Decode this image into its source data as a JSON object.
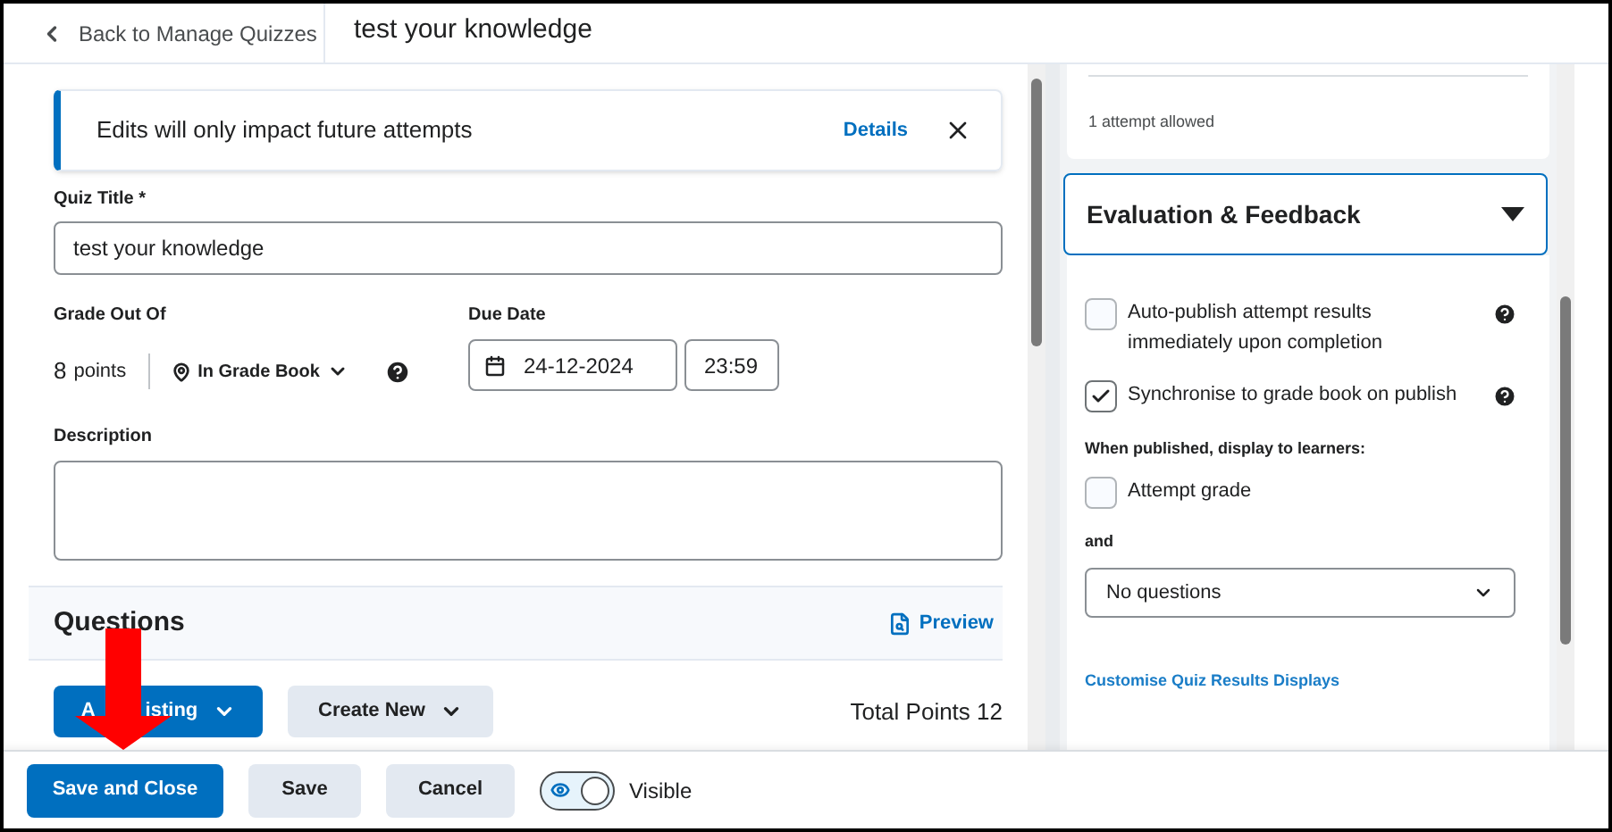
{
  "header": {
    "back_link": "Back to Manage Quizzes",
    "title": "test your knowledge"
  },
  "notice": {
    "text": "Edits will only impact future attempts",
    "link": "Details"
  },
  "quiz_title": {
    "label": "Quiz Title *",
    "value": "test your knowledge"
  },
  "grade": {
    "label": "Grade Out Of",
    "points_value": "8",
    "points_unit": "points",
    "grade_book": "In Grade Book"
  },
  "due_date": {
    "label": "Due Date",
    "date": "24-12-2024",
    "time": "23:59"
  },
  "description": {
    "label": "Description"
  },
  "questions": {
    "title": "Questions",
    "preview": "Preview",
    "buttons": [
      {
        "label_parts": [
          "A",
          "isting"
        ],
        "kind": "primary"
      },
      {
        "label": "Create New",
        "kind": "secondary"
      }
    ],
    "total": "Total Points 12"
  },
  "right_panel": {
    "attempts": "1 attempt allowed",
    "section": {
      "title": "Evaluation & Feedback",
      "expanded": true
    },
    "options": [
      {
        "label": "Auto-publish attempt results immediately upon completion",
        "checked": false,
        "help": true
      },
      {
        "label": "Synchronise to grade book on publish",
        "checked": true,
        "help": true
      }
    ],
    "display_label": "When published, display to learners:",
    "display_options": [
      {
        "label": "Attempt grade",
        "checked": false
      }
    ],
    "and_label": "and",
    "select": {
      "value": "No questions"
    },
    "link": "Customise Quiz Results Displays"
  },
  "footer": {
    "buttons": [
      {
        "label": "Save and Close",
        "kind": "primary"
      },
      {
        "label": "Save",
        "kind": "secondary"
      },
      {
        "label": "Cancel",
        "kind": "secondary"
      }
    ],
    "visibility": {
      "label": "Visible",
      "on": true
    }
  }
}
